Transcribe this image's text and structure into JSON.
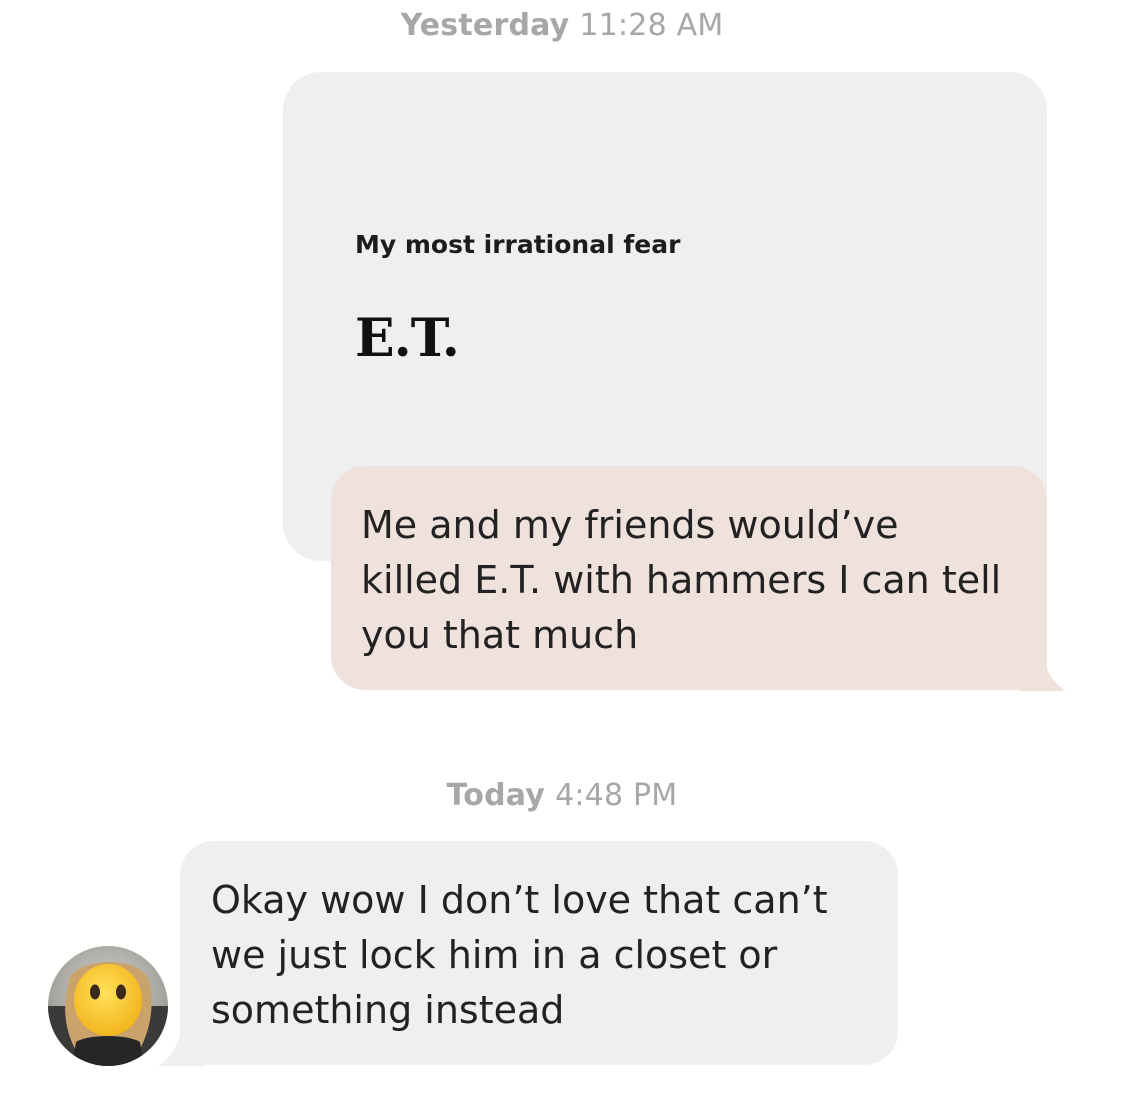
{
  "conversation": {
    "timestamps": [
      {
        "day": "Yesterday",
        "time": "11:28 AM"
      },
      {
        "day": "Today",
        "time": "4:48 PM"
      }
    ],
    "prompt": {
      "question": "My most irrational fear",
      "answer": "E.T."
    },
    "messages": [
      {
        "direction": "sent",
        "text": "Me and my friends would’ve\nkilled E.T. with hammers I can tell\nyou that much"
      },
      {
        "direction": "received",
        "text": "Okay wow I don’t love that can’t\nwe just lock him in a closet or\nsomething instead",
        "avatar_icon": "profile-photo-emoji-face"
      }
    ]
  },
  "colors": {
    "sent_bubble": "#efe1dc",
    "received_bubble": "#efefef",
    "timestamp_text": "#a7a7a7"
  }
}
